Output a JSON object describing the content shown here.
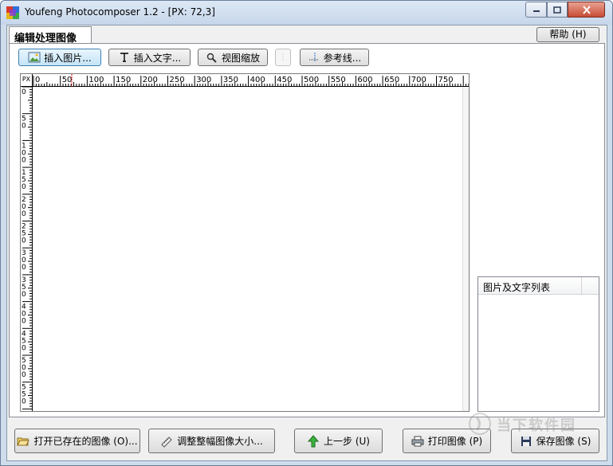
{
  "window": {
    "title": "Youfeng Photocomposer 1.2 - [PX: 72,3]"
  },
  "tab": {
    "label": "编辑处理图像"
  },
  "help_button": "帮助 (H)",
  "toolbar": {
    "insert_image": "插入图片...",
    "insert_text": "插入文字...",
    "zoom": "视图缩放",
    "guides": "参考线..."
  },
  "ruler": {
    "unit": "PX",
    "top_labels": [
      "0",
      "50",
      "100",
      "150",
      "200",
      "250",
      "300",
      "350",
      "400",
      "450",
      "500",
      "550",
      "600",
      "650",
      "700",
      "750"
    ],
    "left_labels": [
      "0",
      "50",
      "100",
      "150",
      "200",
      "250",
      "300",
      "350",
      "400",
      "450",
      "500",
      "550"
    ]
  },
  "list_panel": {
    "column_header": "图片及文字列表",
    "items": []
  },
  "bottom_buttons": {
    "open_existing": "打开已存在的图像 (O)...",
    "resize_whole": "调整整幅图像大小...",
    "undo": "上一步 (U)",
    "print": "打印图像 (P)",
    "save": "保存图像 (S)"
  },
  "watermark": {
    "text": "当下软件园"
  },
  "icons": {
    "app": "app-icon",
    "insert_image": "picture-icon",
    "insert_text": "text-tool-icon",
    "zoom": "magnifier-icon",
    "guides": "guides-icon",
    "open": "open-folder-icon",
    "resize": "ruler-pencil-icon",
    "undo": "green-arrow-up-icon",
    "print": "printer-icon",
    "save": "floppy-disk-icon"
  }
}
